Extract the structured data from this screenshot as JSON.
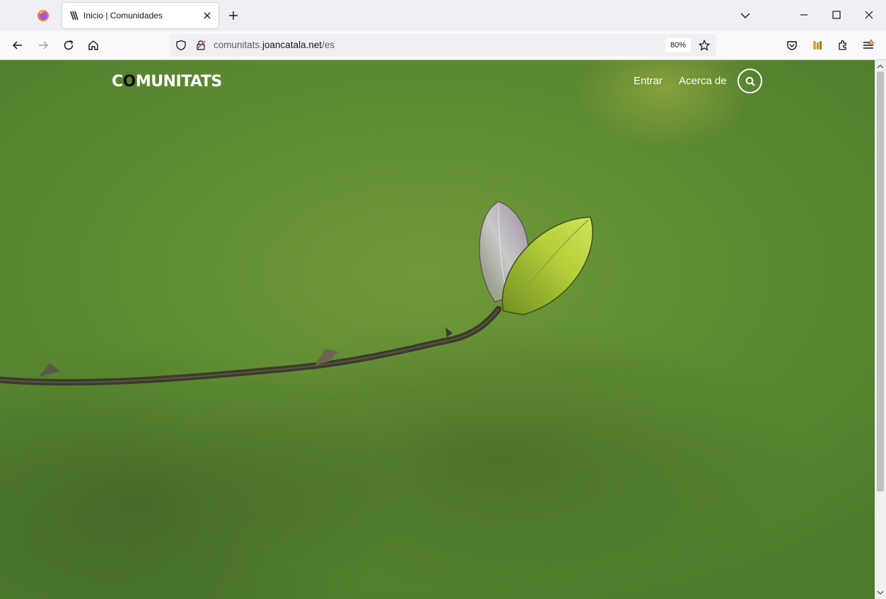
{
  "browser": {
    "tab": {
      "title": "Inicio | Comunidades",
      "favicon": "comunitats-favicon"
    },
    "url": {
      "prefix": "comunitats.",
      "domain": "joancatala.net",
      "path": "/es"
    },
    "zoom": "80%",
    "icons": [
      "firefox-logo-icon",
      "back-icon",
      "forward-icon",
      "reload-icon",
      "home-icon",
      "shield-icon",
      "lock-icon",
      "star-icon",
      "pocket-icon",
      "extension-icon",
      "puzzle-icon",
      "menu-icon"
    ]
  },
  "site": {
    "logo": {
      "first": "C",
      "middle": "O",
      "rest": "MUNITATS"
    },
    "nav": {
      "login": "Entrar",
      "about": "Acerca de"
    }
  },
  "colors": {
    "background_green": "#5d8a31",
    "text": "#ffffff"
  }
}
